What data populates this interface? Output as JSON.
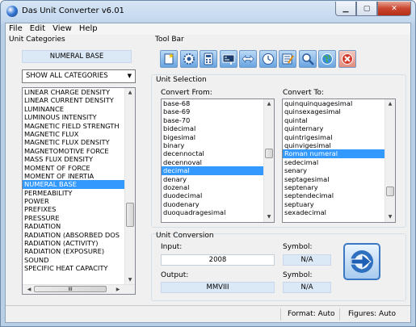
{
  "window": {
    "title": "Das Unit Converter v6.01",
    "icon": "app-globe-icon"
  },
  "menu": [
    "File",
    "Edit",
    "View",
    "Help"
  ],
  "categories": {
    "label": "Unit Categories",
    "selected_display": "NUMERAL BASE",
    "filter": "SHOW ALL CATEGORIES",
    "items": [
      "LINEAR CHARGE DENSITY",
      "LINEAR CURRENT DENSITY",
      "LUMINANCE",
      "LUMINOUS INTENSITY",
      "MAGNETIC FIELD STRENGTH",
      "MAGNETIC FLUX",
      "MAGNETIC FLUX DENSITY",
      "MAGNETOMOTIVE FORCE",
      "MASS FLUX DENSITY",
      "MOMENT OF FORCE",
      "MOMENT OF INERTIA",
      "NUMERAL BASE",
      "PERMEABILITY",
      "POWER",
      "PREFIXES",
      "PRESSURE",
      "RADIATION",
      "RADIATION (ABSORBED DOS",
      "RADIATION (ACTIVITY)",
      "RADIATION (EXPOSURE)",
      "SOUND",
      "SPECIFIC HEAT CAPACITY"
    ],
    "selected_index": 11,
    "hscroll_grip": "III"
  },
  "toolbar": {
    "label": "Tool Bar",
    "buttons": [
      "new-icon",
      "settings-gear-icon",
      "calculator-icon",
      "chalkboard-icon",
      "swap-arrows-icon",
      "clock-icon",
      "notepad-icon",
      "magnifier-icon",
      "globe-icon",
      "exit-icon"
    ]
  },
  "selection": {
    "label": "Unit Selection",
    "from_label": "Convert From:",
    "to_label": "Convert To:",
    "from_items": [
      "base-68",
      "base-69",
      "base-70",
      "bidecimal",
      "bigesimal",
      "binary",
      "decennoctal",
      "decennoval",
      "decimal",
      "denary",
      "dozenal",
      "duodecimal",
      "duodenary",
      "duoquadragesimal"
    ],
    "from_selected_index": 8,
    "to_items": [
      "quinquinquagesimal",
      "quinsexagesimal",
      "quintal",
      "quinternary",
      "quintrigesimal",
      "quinvigesimal",
      "Roman numeral",
      "sedecimal",
      "senary",
      "septagesimal",
      "septenary",
      "septendecimal",
      "septuary",
      "sexadecimal"
    ],
    "to_selected_index": 6
  },
  "conversion": {
    "label": "Unit Conversion",
    "input_label": "Input:",
    "input_value": "2008",
    "input_symbol_label": "Symbol:",
    "input_symbol": "N/A",
    "output_label": "Output:",
    "output_value": "MMVIII",
    "output_symbol_label": "Symbol:",
    "output_symbol": "N/A",
    "convert_icon": "convert-arrows-icon"
  },
  "status": {
    "format": "Format: Auto",
    "figures": "Figures: Auto"
  },
  "colors": {
    "selection": "#3399ff",
    "field_blue": "#dbe8f5",
    "title_bar": "#c4d8ee",
    "close_red": "#c9452e"
  }
}
